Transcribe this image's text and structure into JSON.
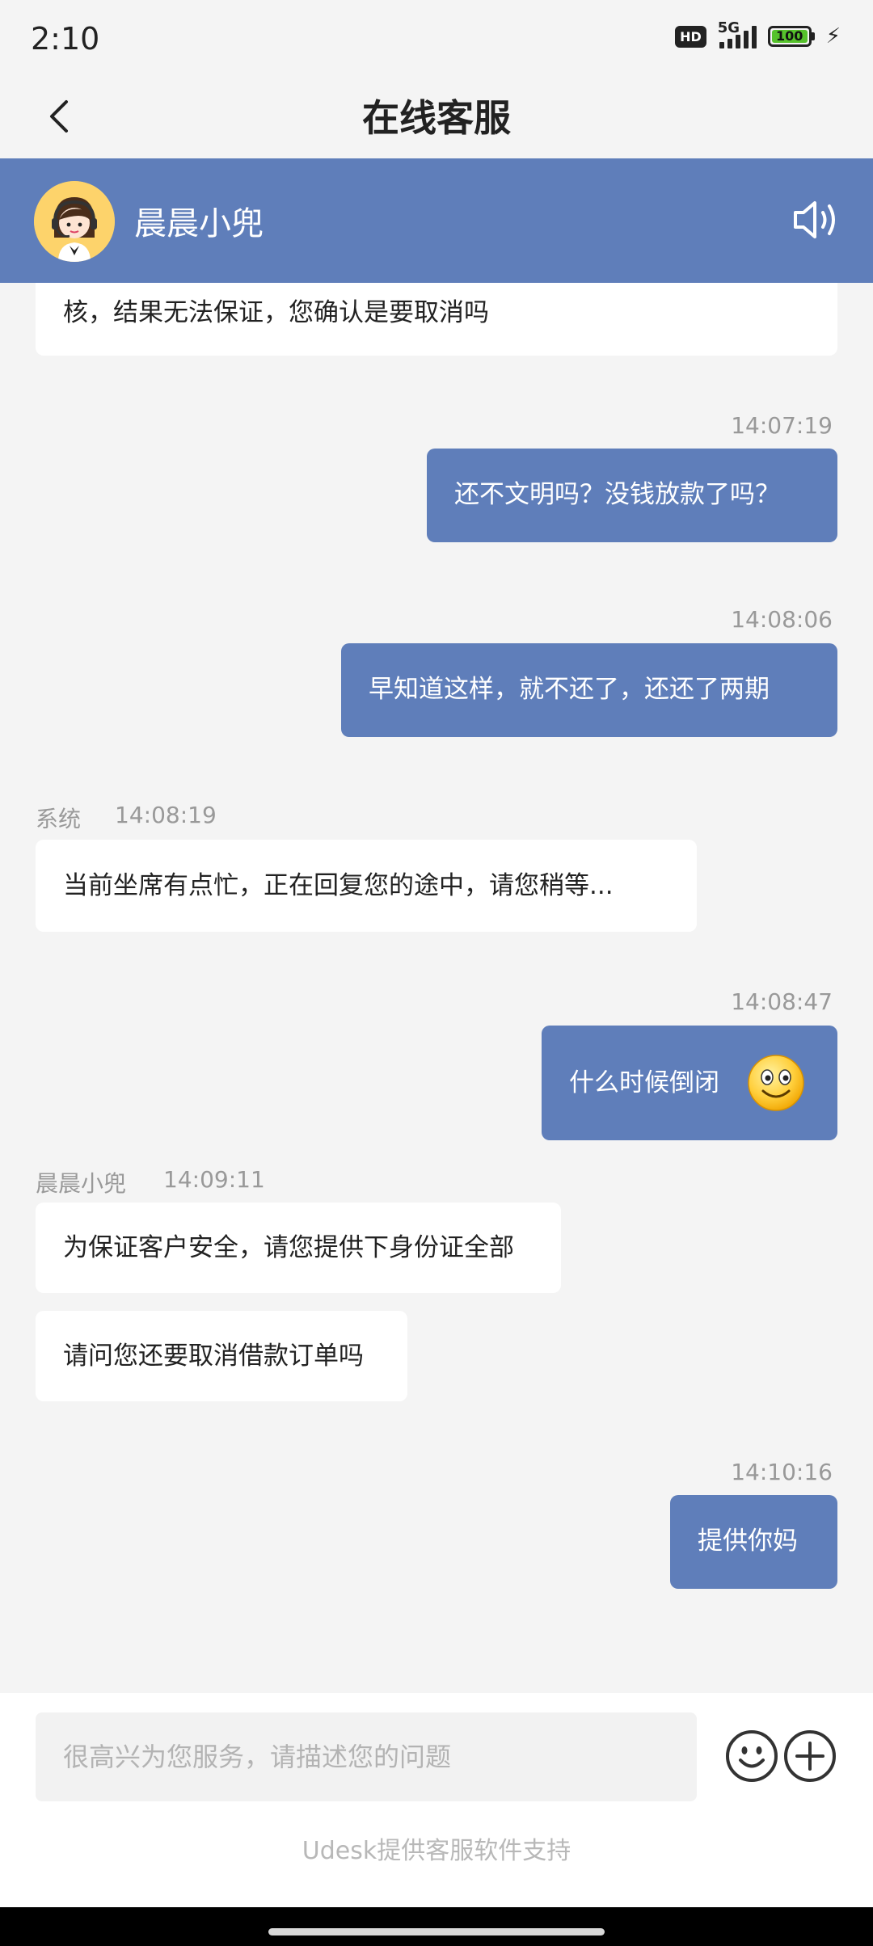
{
  "status_bar": {
    "time": "2:10",
    "hd": "HD",
    "network": "5G",
    "battery": "100"
  },
  "header": {
    "title": "在线客服"
  },
  "agent": {
    "name": "晨晨小兜"
  },
  "chat": {
    "first_partial": "核，结果无法保证，您确认是要取消吗",
    "ts1": "14:07:19",
    "msg1": "还不文明吗？没钱放款了吗？",
    "ts2": "14:08:06",
    "msg2": "早知道这样，就不还了，还还了两期",
    "sys_sender": "系统",
    "sys_time": "14:08:19",
    "sys_msg": "当前坐席有点忙，正在回复您的途中，请您稍等...",
    "ts3": "14:08:47",
    "msg3": "什么时候倒闭",
    "agent_sender": "晨晨小兜",
    "agent_time": "14:09:11",
    "agent_msg1": "为保证客户安全，请您提供下身份证全部",
    "agent_msg2": "请问您还要取消借款订单吗",
    "ts4": "14:10:16",
    "msg4": "提供你妈"
  },
  "input": {
    "placeholder": "很高兴为您服务，请描述您的问题"
  },
  "footer": {
    "powered_by": "Udesk提供客服软件支持"
  },
  "colors": {
    "accent": "#5f7eba",
    "background": "#f4f4f4"
  }
}
